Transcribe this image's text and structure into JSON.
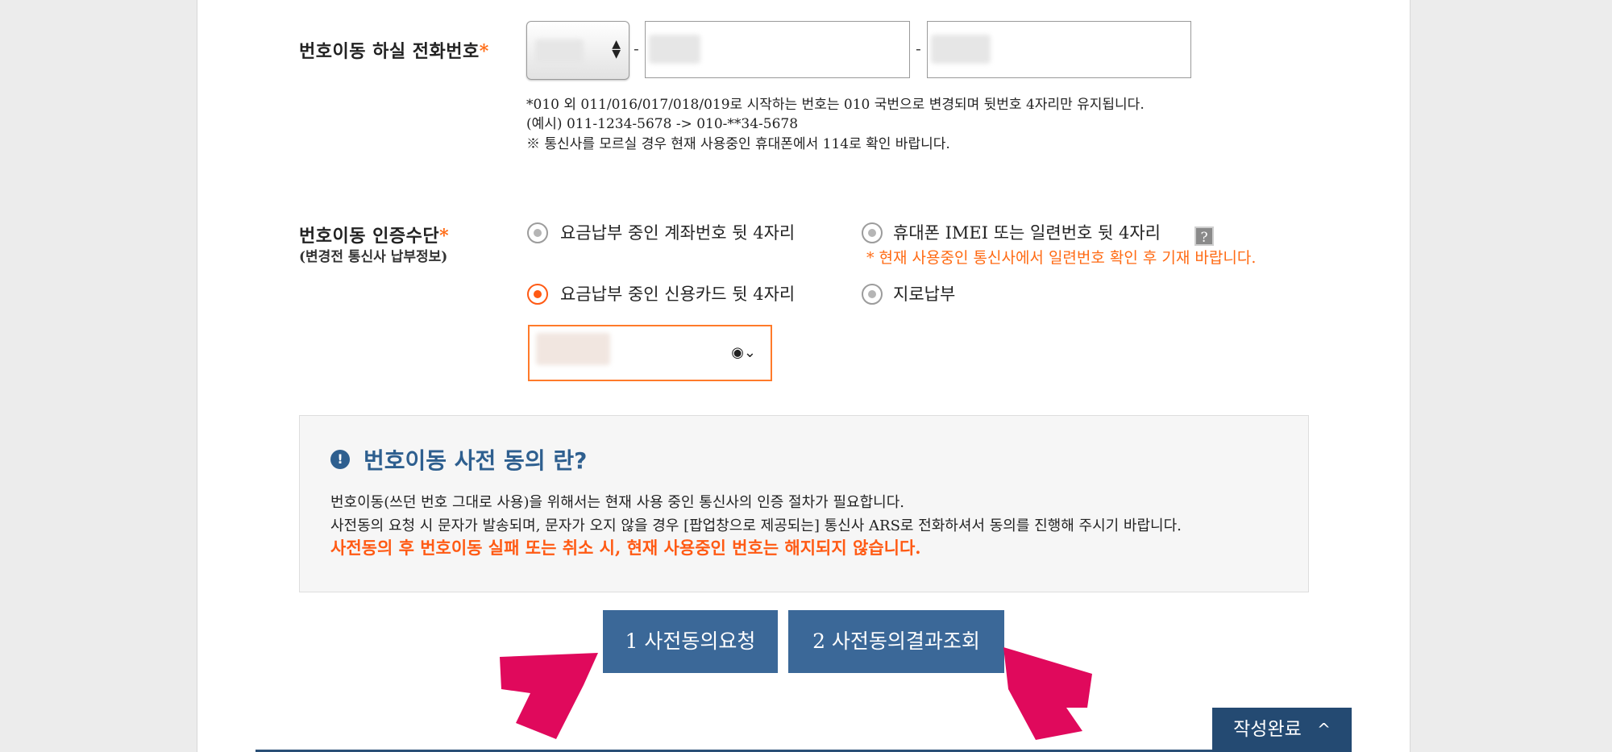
{
  "phone_field": {
    "label": "번호이동 하실 전화번호",
    "required_mark": "*",
    "separator": "-",
    "notes": [
      "*010 외 011/016/017/018/019로 시작하는 번호는 010 국번으로 변경되며 뒷번호 4자리만 유지됩니다.",
      "(예시) 011-1234-5678 -> 010-**34-5678",
      "※ 통신사를 모르실 경우 현재 사용중인 휴대폰에서 114로 확인 바랍니다."
    ]
  },
  "auth_field": {
    "label": "번호이동 인증수단",
    "required_mark": "*",
    "sublabel": "(변경전 통신사 납부정보)",
    "options": [
      {
        "label": "요금납부 중인 계좌번호 뒷 4자리",
        "selected": false
      },
      {
        "label": "휴대폰 IMEI 또는 일련번호 뒷 4자리",
        "selected": false
      },
      {
        "label": "요금납부 중인 신용카드 뒷 4자리",
        "selected": true
      },
      {
        "label": "지로납부",
        "selected": false
      }
    ],
    "imei_warning": "* 현재 사용중인 통신사에서 일련번호 확인 후 기재 바랍니다.",
    "help_glyph": "?"
  },
  "consent": {
    "icon_glyph": "!",
    "title": "번호이동 사전 동의 란?",
    "lines": [
      "번호이동(쓰던 번호 그대로 사용)을 위해서는 현재 사용 중인 통신사의 인증 절차가 필요합니다.",
      "사전동의 요청 시 문자가 발송되며, 문자가 오지 않을 경우 [팝업창으로 제공되는] 통신사 ARS로 전화하셔서 동의를 진행해 주시기 바랍니다."
    ],
    "warning": "사전동의 후 번호이동 실패 또는 취소 시, 현재 사용중인 번호는 해지되지 않습니다."
  },
  "buttons": {
    "request": "1 사전동의요청",
    "check_result": "2 사전동의결과조회",
    "done": "작성완료",
    "done_chevron": "^"
  },
  "colors": {
    "accent_orange": "#ff6a13",
    "primary_blue": "#3b6898",
    "arrow_pink": "#e0095c"
  }
}
